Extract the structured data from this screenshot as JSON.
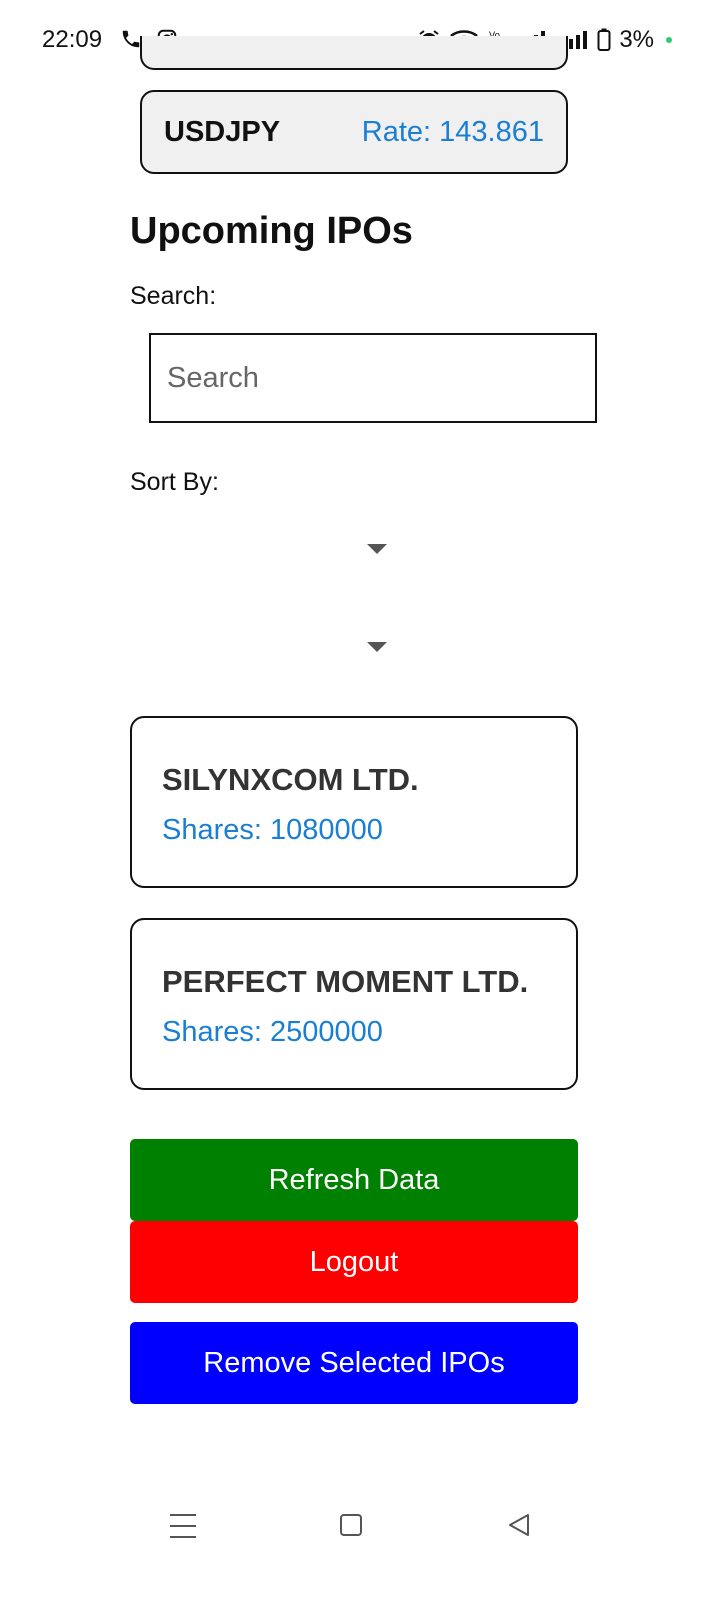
{
  "status_bar": {
    "time": "22:09",
    "icons_left": [
      "phone-icon",
      "instagram-icon"
    ],
    "icons_right": [
      "alarm-icon",
      "wifi-icon",
      "volte-icon",
      "signal-icon",
      "signal-icon",
      "battery-icon"
    ],
    "battery_text": "3%",
    "dot_color": "#2ecc71"
  },
  "rate_card": {
    "pair": "USDJPY",
    "rate": "Rate: 143.861"
  },
  "main": {
    "title": "Upcoming IPOs",
    "search_label": "Search:",
    "search_placeholder": "Search",
    "search_value": "",
    "sort_label": "Sort By:",
    "dropdowns": [
      {
        "selected": ""
      },
      {
        "selected": ""
      }
    ]
  },
  "ipos": [
    {
      "name": "SILYNXCOM LTD.",
      "shares": "Shares: 1080000"
    },
    {
      "name": "PERFECT MOMENT LTD.",
      "shares": "Shares: 2500000"
    }
  ],
  "buttons": {
    "refresh": "Refresh Data",
    "logout": "Logout",
    "remove": "Remove Selected IPOs"
  },
  "colors": {
    "accent_blue": "#1a7fd4",
    "refresh_bg": "#008000",
    "logout_bg": "#ff0000",
    "remove_bg": "#0000ff"
  },
  "nav_bar": {
    "icons": [
      "menu-icon",
      "home-icon",
      "back-icon"
    ]
  }
}
